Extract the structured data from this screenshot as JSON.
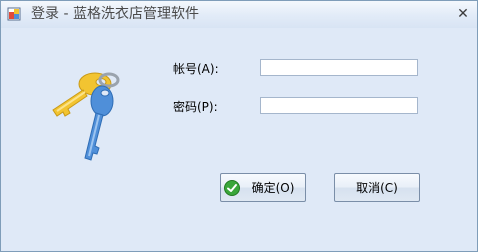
{
  "window": {
    "title": "登录 - 蓝格洗衣店管理软件",
    "close_glyph": "✕",
    "app_icon": "app-icon",
    "close_icon": "close-icon"
  },
  "illustration": {
    "icon": "keys-icon",
    "colors": {
      "gold_key": "#f2c431",
      "blue_key": "#4f8fd9"
    }
  },
  "form": {
    "account_label": "帐号(A):",
    "account_value": "",
    "password_label": "密码(P):",
    "password_value": ""
  },
  "buttons": {
    "ok_label": "确定(O)",
    "ok_icon": "checkmark-icon",
    "ok_icon_color": "#3aa63a",
    "cancel_label": "取消(C)"
  }
}
